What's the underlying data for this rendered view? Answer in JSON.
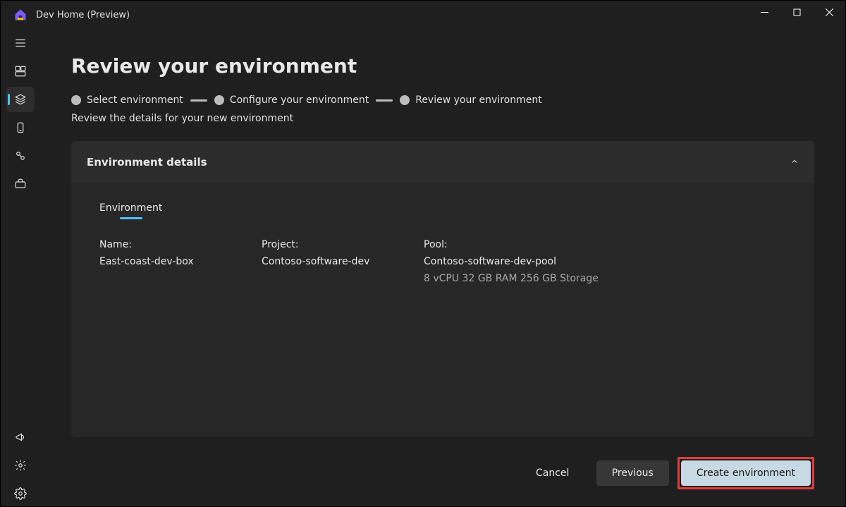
{
  "window": {
    "title": "Dev Home (Preview)"
  },
  "page": {
    "title": "Review your environment",
    "subtitle": "Review the details for your new environment"
  },
  "stepper": {
    "steps": [
      {
        "label": "Select environment"
      },
      {
        "label": "Configure your environment"
      },
      {
        "label": "Review your environment"
      }
    ]
  },
  "card": {
    "title": "Environment details",
    "tab_label": "Environment",
    "properties": {
      "name_label": "Name:",
      "name_value": "East-coast-dev-box",
      "project_label": "Project:",
      "project_value": "Contoso-software-dev",
      "pool_label": "Pool:",
      "pool_value": "Contoso-software-dev-pool",
      "pool_specs": "8 vCPU 32 GB RAM 256 GB Storage"
    }
  },
  "footer": {
    "cancel": "Cancel",
    "previous": "Previous",
    "create": "Create environment"
  }
}
